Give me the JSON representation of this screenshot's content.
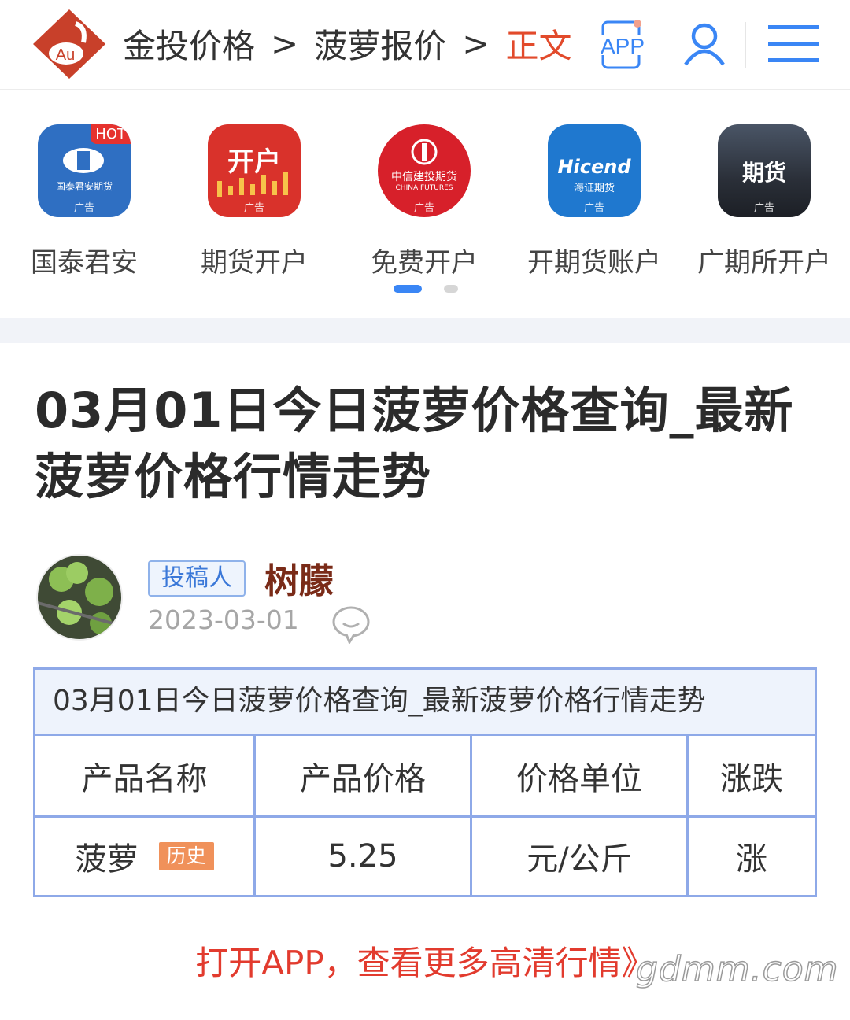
{
  "header": {
    "logo_text": "Au",
    "breadcrumb": [
      "金投价格",
      "菠萝报价",
      "正文"
    ],
    "separator": ">",
    "app_label": "APP"
  },
  "ads": {
    "items": [
      {
        "label": "国泰君安",
        "tile_text": "国泰君安期货",
        "badge": "HOT",
        "ad_tag": "广告"
      },
      {
        "label": "期货开户",
        "tile_text": "开户",
        "ad_tag": "广告"
      },
      {
        "label": "免费开户",
        "tile_text": "中信建投期货",
        "tile_sub": "CHINA FUTURES",
        "ad_tag": "广告"
      },
      {
        "label": "开期货账户",
        "tile_text": "Hicend",
        "tile_sub": "海证期货",
        "ad_tag": "广告"
      },
      {
        "label": "广期所开户",
        "tile_text": "期货",
        "ad_tag": "广告"
      }
    ],
    "page_indicator": {
      "current": 1,
      "total": 2
    }
  },
  "article": {
    "title": "03月01日今日菠萝价格查询_最新菠萝价格行情走势",
    "author_tag": "投稿人",
    "author": "树朦",
    "date": "2023-03-01"
  },
  "table": {
    "caption": "03月01日今日菠萝价格查询_最新菠萝价格行情走势",
    "headers": [
      "产品名称",
      "产品价格",
      "价格单位",
      "涨跌"
    ],
    "row": {
      "name": "菠萝",
      "history_label": "历史",
      "price": "5.25",
      "unit": "元/公斤",
      "change": "涨"
    }
  },
  "cta": "打开APP，查看更多高清行情》",
  "watermark": "gdmm.com",
  "colors": {
    "accent_red": "#e24a2b",
    "accent_blue": "#3a86f5",
    "table_border": "#8ea9e8",
    "author": "#7a2b18"
  }
}
